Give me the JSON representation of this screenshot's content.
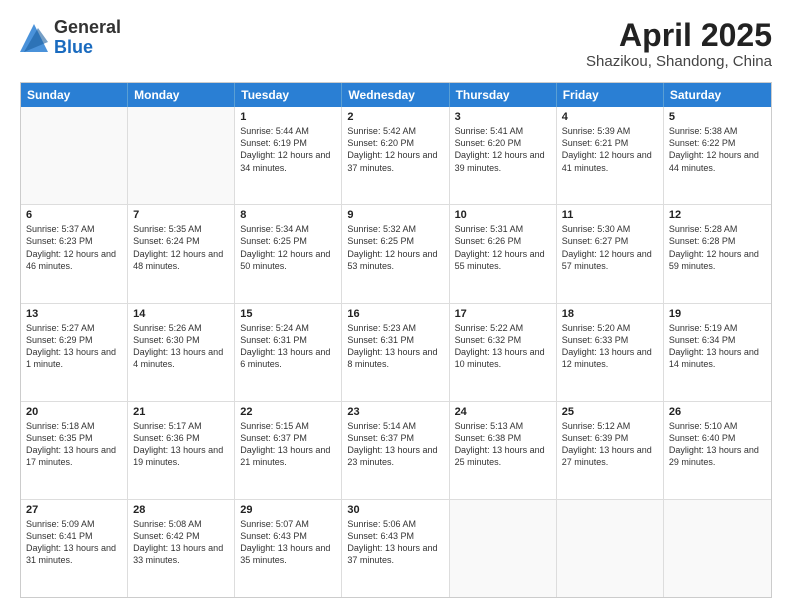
{
  "header": {
    "logo_general": "General",
    "logo_blue": "Blue",
    "month_year": "April 2025",
    "location": "Shazikou, Shandong, China"
  },
  "days_of_week": [
    "Sunday",
    "Monday",
    "Tuesday",
    "Wednesday",
    "Thursday",
    "Friday",
    "Saturday"
  ],
  "weeks": [
    [
      {
        "day": "",
        "info": ""
      },
      {
        "day": "",
        "info": ""
      },
      {
        "day": "1",
        "info": "Sunrise: 5:44 AM\nSunset: 6:19 PM\nDaylight: 12 hours and 34 minutes."
      },
      {
        "day": "2",
        "info": "Sunrise: 5:42 AM\nSunset: 6:20 PM\nDaylight: 12 hours and 37 minutes."
      },
      {
        "day": "3",
        "info": "Sunrise: 5:41 AM\nSunset: 6:20 PM\nDaylight: 12 hours and 39 minutes."
      },
      {
        "day": "4",
        "info": "Sunrise: 5:39 AM\nSunset: 6:21 PM\nDaylight: 12 hours and 41 minutes."
      },
      {
        "day": "5",
        "info": "Sunrise: 5:38 AM\nSunset: 6:22 PM\nDaylight: 12 hours and 44 minutes."
      }
    ],
    [
      {
        "day": "6",
        "info": "Sunrise: 5:37 AM\nSunset: 6:23 PM\nDaylight: 12 hours and 46 minutes."
      },
      {
        "day": "7",
        "info": "Sunrise: 5:35 AM\nSunset: 6:24 PM\nDaylight: 12 hours and 48 minutes."
      },
      {
        "day": "8",
        "info": "Sunrise: 5:34 AM\nSunset: 6:25 PM\nDaylight: 12 hours and 50 minutes."
      },
      {
        "day": "9",
        "info": "Sunrise: 5:32 AM\nSunset: 6:25 PM\nDaylight: 12 hours and 53 minutes."
      },
      {
        "day": "10",
        "info": "Sunrise: 5:31 AM\nSunset: 6:26 PM\nDaylight: 12 hours and 55 minutes."
      },
      {
        "day": "11",
        "info": "Sunrise: 5:30 AM\nSunset: 6:27 PM\nDaylight: 12 hours and 57 minutes."
      },
      {
        "day": "12",
        "info": "Sunrise: 5:28 AM\nSunset: 6:28 PM\nDaylight: 12 hours and 59 minutes."
      }
    ],
    [
      {
        "day": "13",
        "info": "Sunrise: 5:27 AM\nSunset: 6:29 PM\nDaylight: 13 hours and 1 minute."
      },
      {
        "day": "14",
        "info": "Sunrise: 5:26 AM\nSunset: 6:30 PM\nDaylight: 13 hours and 4 minutes."
      },
      {
        "day": "15",
        "info": "Sunrise: 5:24 AM\nSunset: 6:31 PM\nDaylight: 13 hours and 6 minutes."
      },
      {
        "day": "16",
        "info": "Sunrise: 5:23 AM\nSunset: 6:31 PM\nDaylight: 13 hours and 8 minutes."
      },
      {
        "day": "17",
        "info": "Sunrise: 5:22 AM\nSunset: 6:32 PM\nDaylight: 13 hours and 10 minutes."
      },
      {
        "day": "18",
        "info": "Sunrise: 5:20 AM\nSunset: 6:33 PM\nDaylight: 13 hours and 12 minutes."
      },
      {
        "day": "19",
        "info": "Sunrise: 5:19 AM\nSunset: 6:34 PM\nDaylight: 13 hours and 14 minutes."
      }
    ],
    [
      {
        "day": "20",
        "info": "Sunrise: 5:18 AM\nSunset: 6:35 PM\nDaylight: 13 hours and 17 minutes."
      },
      {
        "day": "21",
        "info": "Sunrise: 5:17 AM\nSunset: 6:36 PM\nDaylight: 13 hours and 19 minutes."
      },
      {
        "day": "22",
        "info": "Sunrise: 5:15 AM\nSunset: 6:37 PM\nDaylight: 13 hours and 21 minutes."
      },
      {
        "day": "23",
        "info": "Sunrise: 5:14 AM\nSunset: 6:37 PM\nDaylight: 13 hours and 23 minutes."
      },
      {
        "day": "24",
        "info": "Sunrise: 5:13 AM\nSunset: 6:38 PM\nDaylight: 13 hours and 25 minutes."
      },
      {
        "day": "25",
        "info": "Sunrise: 5:12 AM\nSunset: 6:39 PM\nDaylight: 13 hours and 27 minutes."
      },
      {
        "day": "26",
        "info": "Sunrise: 5:10 AM\nSunset: 6:40 PM\nDaylight: 13 hours and 29 minutes."
      }
    ],
    [
      {
        "day": "27",
        "info": "Sunrise: 5:09 AM\nSunset: 6:41 PM\nDaylight: 13 hours and 31 minutes."
      },
      {
        "day": "28",
        "info": "Sunrise: 5:08 AM\nSunset: 6:42 PM\nDaylight: 13 hours and 33 minutes."
      },
      {
        "day": "29",
        "info": "Sunrise: 5:07 AM\nSunset: 6:43 PM\nDaylight: 13 hours and 35 minutes."
      },
      {
        "day": "30",
        "info": "Sunrise: 5:06 AM\nSunset: 6:43 PM\nDaylight: 13 hours and 37 minutes."
      },
      {
        "day": "",
        "info": ""
      },
      {
        "day": "",
        "info": ""
      },
      {
        "day": "",
        "info": ""
      }
    ]
  ]
}
